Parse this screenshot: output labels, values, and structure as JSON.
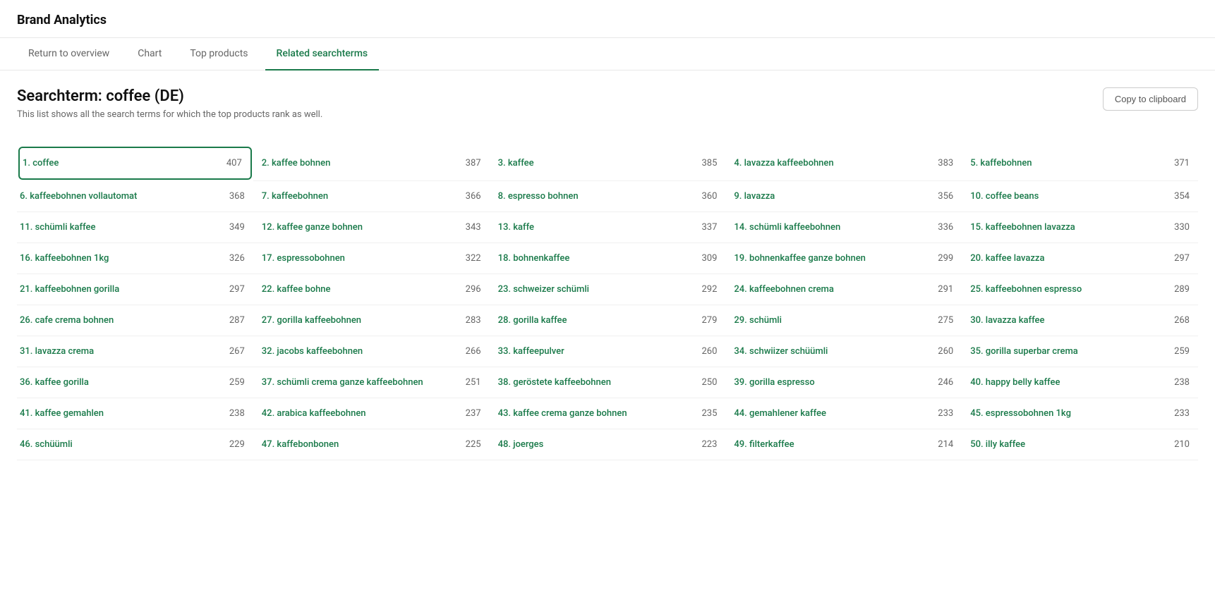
{
  "app": {
    "title": "Brand Analytics"
  },
  "nav": {
    "tabs": [
      {
        "id": "return",
        "label": "Return to overview",
        "active": false
      },
      {
        "id": "chart",
        "label": "Chart",
        "active": false
      },
      {
        "id": "top-products",
        "label": "Top products",
        "active": false
      },
      {
        "id": "related-searchterms",
        "label": "Related searchterms",
        "active": true
      }
    ]
  },
  "page": {
    "title": "Searchterm: coffee (DE)",
    "description": "This list shows all the search terms for which the top products rank as well.",
    "copy_button_label": "Copy to clipboard"
  },
  "items": [
    {
      "rank": 1,
      "term": "coffee",
      "count": 407
    },
    {
      "rank": 2,
      "term": "kaffee bohnen",
      "count": 387
    },
    {
      "rank": 3,
      "term": "kaffee",
      "count": 385
    },
    {
      "rank": 4,
      "term": "lavazza kaffeebohnen",
      "count": 383
    },
    {
      "rank": 5,
      "term": "kaffebohnen",
      "count": 371
    },
    {
      "rank": 6,
      "term": "kaffeebohnen vollautomat",
      "count": 368
    },
    {
      "rank": 7,
      "term": "kaffeebohnen",
      "count": 366
    },
    {
      "rank": 8,
      "term": "espresso bohnen",
      "count": 360
    },
    {
      "rank": 9,
      "term": "lavazza",
      "count": 356
    },
    {
      "rank": 10,
      "term": "coffee beans",
      "count": 354
    },
    {
      "rank": 11,
      "term": "schümli kaffee",
      "count": 349
    },
    {
      "rank": 12,
      "term": "kaffee ganze bohnen",
      "count": 343
    },
    {
      "rank": 13,
      "term": "kaffe",
      "count": 337
    },
    {
      "rank": 14,
      "term": "schümli kaffeebohnen",
      "count": 336
    },
    {
      "rank": 15,
      "term": "kaffeebohnen lavazza",
      "count": 330
    },
    {
      "rank": 16,
      "term": "kaffeebohnen 1kg",
      "count": 326
    },
    {
      "rank": 17,
      "term": "espressobohnen",
      "count": 322
    },
    {
      "rank": 18,
      "term": "bohnenkaffee",
      "count": 309
    },
    {
      "rank": 19,
      "term": "bohnenkaffee ganze bohnen",
      "count": 299
    },
    {
      "rank": 20,
      "term": "kaffee lavazza",
      "count": 297
    },
    {
      "rank": 21,
      "term": "kaffeebohnen gorilla",
      "count": 297
    },
    {
      "rank": 22,
      "term": "kaffee bohne",
      "count": 296
    },
    {
      "rank": 23,
      "term": "schweizer schümli",
      "count": 292
    },
    {
      "rank": 24,
      "term": "kaffeebohnen crema",
      "count": 291
    },
    {
      "rank": 25,
      "term": "kaffeebohnen espresso",
      "count": 289
    },
    {
      "rank": 26,
      "term": "cafe crema bohnen",
      "count": 287
    },
    {
      "rank": 27,
      "term": "gorilla kaffeebohnen",
      "count": 283
    },
    {
      "rank": 28,
      "term": "gorilla kaffee",
      "count": 279
    },
    {
      "rank": 29,
      "term": "schümli",
      "count": 275
    },
    {
      "rank": 30,
      "term": "lavazza kaffee",
      "count": 268
    },
    {
      "rank": 31,
      "term": "lavazza crema",
      "count": 267
    },
    {
      "rank": 32,
      "term": "jacobs kaffeebohnen",
      "count": 266
    },
    {
      "rank": 33,
      "term": "kaffeepulver",
      "count": 260
    },
    {
      "rank": 34,
      "term": "schwiizer schüümli",
      "count": 260
    },
    {
      "rank": 35,
      "term": "gorilla superbar crema",
      "count": 259
    },
    {
      "rank": 36,
      "term": "kaffee gorilla",
      "count": 259
    },
    {
      "rank": 37,
      "term": "schümli crema ganze kaffeebohnen",
      "count": 251
    },
    {
      "rank": 38,
      "term": "geröstete kaffeebohnen",
      "count": 250
    },
    {
      "rank": 39,
      "term": "gorilla espresso",
      "count": 246
    },
    {
      "rank": 40,
      "term": "happy belly kaffee",
      "count": 238
    },
    {
      "rank": 41,
      "term": "kaffee gemahlen",
      "count": 238
    },
    {
      "rank": 42,
      "term": "arabica kaffeebohnen",
      "count": 237
    },
    {
      "rank": 43,
      "term": "kaffee crema ganze bohnen",
      "count": 235
    },
    {
      "rank": 44,
      "term": "gemahlener kaffee",
      "count": 233
    },
    {
      "rank": 45,
      "term": "espressobohnen 1kg",
      "count": 233
    },
    {
      "rank": 46,
      "term": "schüümli",
      "count": 229
    },
    {
      "rank": 47,
      "term": "kaffebonbonen",
      "count": 225
    },
    {
      "rank": 48,
      "term": "joerges",
      "count": 223
    },
    {
      "rank": 49,
      "term": "filterkaffee",
      "count": 214
    },
    {
      "rank": 50,
      "term": "illy kaffee",
      "count": 210
    }
  ]
}
